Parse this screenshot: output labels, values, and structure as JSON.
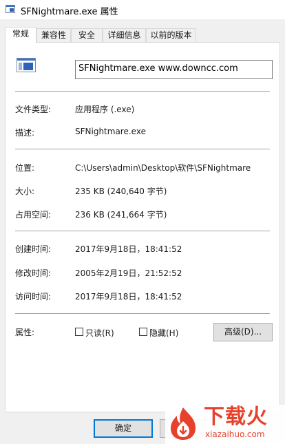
{
  "window": {
    "title": "SFNightmare.exe 属性"
  },
  "tabs": [
    {
      "label": "常规",
      "active": true
    },
    {
      "label": "兼容性",
      "active": false
    },
    {
      "label": "安全",
      "active": false
    },
    {
      "label": "详细信息",
      "active": false
    },
    {
      "label": "以前的版本",
      "active": false
    }
  ],
  "general": {
    "file_name": "SFNightmare.exe  www.downcc.com",
    "type_label": "文件类型:",
    "type_value": "应用程序 (.exe)",
    "desc_label": "描述:",
    "desc_value": "SFNightmare.exe",
    "location_label": "位置:",
    "location_value": "C:\\Users\\admin\\Desktop\\软件\\SFNightmare",
    "size_label": "大小:",
    "size_value": "235 KB (240,640 字节)",
    "disk_label": "占用空间:",
    "disk_value": "236 KB (241,664 字节)",
    "created_label": "创建时间:",
    "created_value": "2017年9月18日，18:41:52",
    "modified_label": "修改时间:",
    "modified_value": "2005年2月19日，21:52:52",
    "accessed_label": "访问时间:",
    "accessed_value": "2017年9月18日，18:41:52",
    "attributes_label": "属性:",
    "readonly_label": "只读(R)",
    "readonly_checked": false,
    "hidden_label": "隐藏(H)",
    "hidden_checked": false,
    "advanced_button": "高级(D)..."
  },
  "footer": {
    "ok_label": "确定",
    "cancel_label": ""
  },
  "watermark": {
    "text": "下载火",
    "sub": "xiazaihuo.com",
    "color": "#e8412b"
  },
  "icons": {
    "title_icon": "application-window-icon",
    "file_icon": "exe-file-icon",
    "logo_icon": "flame-logo-icon"
  }
}
